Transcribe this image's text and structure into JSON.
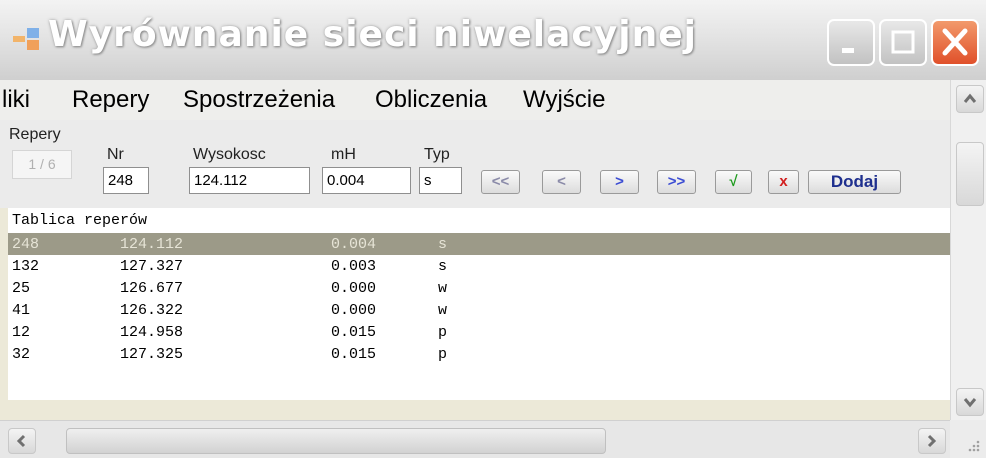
{
  "window": {
    "title": "Wyrównanie sieci niwelacyjnej"
  },
  "menu": {
    "items": [
      "liki",
      "Repery",
      "Spostrzeżenia",
      "Obliczenia",
      "Wyjście"
    ]
  },
  "form": {
    "group_label": "Repery",
    "counter": "1 / 6",
    "labels": {
      "nr": "Nr",
      "wysokosc": "Wysokosc",
      "mh": "mH",
      "typ": "Typ"
    },
    "values": {
      "nr": "248",
      "wysokosc": "124.112",
      "mh": "0.004",
      "typ": "s"
    },
    "buttons": {
      "first": "<<",
      "prev": "<",
      "next": ">",
      "last": ">>",
      "confirm": "√",
      "delete": "x",
      "add": "Dodaj"
    }
  },
  "table": {
    "title": "Tablica reperów",
    "selected_index": 0,
    "rows": [
      [
        "248",
        "124.112",
        "0.004",
        "s"
      ],
      [
        "132",
        "127.327",
        "0.003",
        "s"
      ],
      [
        "25",
        "126.677",
        "0.000",
        "w"
      ],
      [
        "41",
        "126.322",
        "0.000",
        "w"
      ],
      [
        "12",
        "124.958",
        "0.015",
        "p"
      ],
      [
        "32",
        "127.325",
        "0.015",
        "p"
      ]
    ]
  },
  "icons": {
    "app": "app-icon",
    "minimize": "minimize-icon",
    "maximize": "maximize-icon",
    "close": "close-icon",
    "scroll_up": "chevron-up-icon",
    "scroll_down": "chevron-down-icon",
    "scroll_left": "chevron-left-icon",
    "scroll_right": "chevron-right-icon",
    "resize": "resize-grip-icon"
  },
  "colors": {
    "selected_row": "#9c9a88",
    "close_button": "#e0502a",
    "nav_button_text": "#3b4cd3",
    "confirm_text": "#1e9b1e",
    "delete_text": "#d22020"
  }
}
